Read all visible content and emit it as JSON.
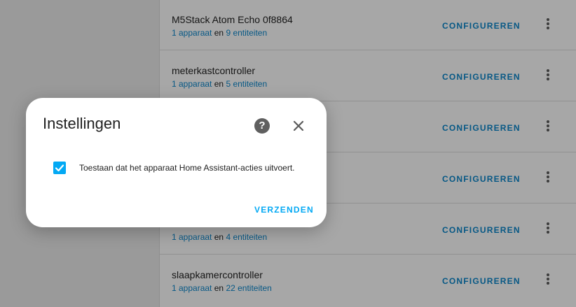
{
  "integrations": [
    {
      "title": "M5Stack Atom Echo 0f8864",
      "devices": "1 apparaat",
      "conj": "en",
      "entities": "9 entiteiten",
      "configure": "CONFIGUREREN"
    },
    {
      "title": "meterkastcontroller",
      "devices": "1 apparaat",
      "conj": "en",
      "entities": "5 entiteiten",
      "configure": "CONFIGUREREN"
    },
    {
      "title": "",
      "devices": "",
      "conj": "",
      "entities": "",
      "configure": "CONFIGUREREN"
    },
    {
      "title": "",
      "devices": "",
      "conj": "",
      "entities": "",
      "configure": "CONFIGUREREN"
    },
    {
      "title": "",
      "devices": "1 apparaat",
      "conj": "en",
      "entities": "4 entiteiten",
      "configure": "CONFIGUREREN"
    },
    {
      "title": "slaapkamercontroller",
      "devices": "1 apparaat",
      "conj": "en",
      "entities": "22 entiteiten",
      "configure": "CONFIGUREREN"
    }
  ],
  "dialog": {
    "title": "Instellingen",
    "help_glyph": "?",
    "checkbox_label": "Toestaan dat het apparaat Home Assistant-acties uitvoert.",
    "checkbox_checked": true,
    "submit_label": "VERZENDEN"
  },
  "colors": {
    "accent": "#03a9f4",
    "link": "#0b84c7"
  },
  "icons": {
    "help": "help-circle-icon",
    "close": "close-icon",
    "check": "check-icon",
    "overflow": "dots-vertical-icon"
  }
}
